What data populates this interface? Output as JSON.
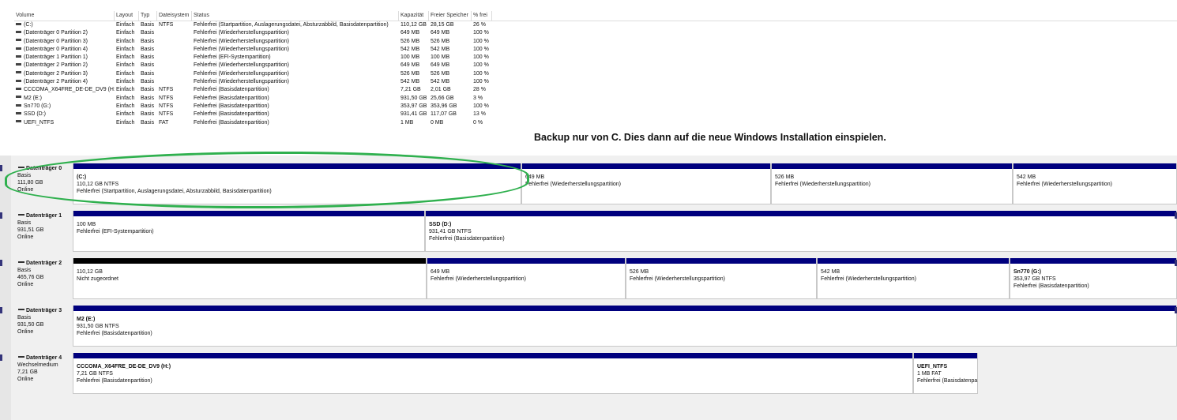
{
  "volume_list": {
    "headers": [
      "Volume",
      "Layout",
      "Typ",
      "Dateisystem",
      "Status",
      "Kapazität",
      "Freier Speicher",
      "% frei"
    ],
    "rows": [
      [
        "(C:)",
        "Einfach",
        "Basis",
        "NTFS",
        "Fehlerfrei (Startpartition, Auslagerungsdatei, Absturzabbild, Basisdatenpartition)",
        "110,12 GB",
        "28,15 GB",
        "26 %"
      ],
      [
        "(Datenträger 0 Partition 2)",
        "Einfach",
        "Basis",
        "",
        "Fehlerfrei (Wiederherstellungspartition)",
        "649 MB",
        "649 MB",
        "100 %"
      ],
      [
        "(Datenträger 0 Partition 3)",
        "Einfach",
        "Basis",
        "",
        "Fehlerfrei (Wiederherstellungspartition)",
        "526 MB",
        "526 MB",
        "100 %"
      ],
      [
        "(Datenträger 0 Partition 4)",
        "Einfach",
        "Basis",
        "",
        "Fehlerfrei (Wiederherstellungspartition)",
        "542 MB",
        "542 MB",
        "100 %"
      ],
      [
        "(Datenträger 1 Partition 1)",
        "Einfach",
        "Basis",
        "",
        "Fehlerfrei (EFI-Systempartition)",
        "100 MB",
        "100 MB",
        "100 %"
      ],
      [
        "(Datenträger 2 Partition 2)",
        "Einfach",
        "Basis",
        "",
        "Fehlerfrei (Wiederherstellungspartition)",
        "649 MB",
        "649 MB",
        "100 %"
      ],
      [
        "(Datenträger 2 Partition 3)",
        "Einfach",
        "Basis",
        "",
        "Fehlerfrei (Wiederherstellungspartition)",
        "526 MB",
        "526 MB",
        "100 %"
      ],
      [
        "(Datenträger 2 Partition 4)",
        "Einfach",
        "Basis",
        "",
        "Fehlerfrei (Wiederherstellungspartition)",
        "542 MB",
        "542 MB",
        "100 %"
      ],
      [
        "CCCOMA_X64FRE_DE-DE_DV9 (H:)",
        "Einfach",
        "Basis",
        "NTFS",
        "Fehlerfrei (Basisdatenpartition)",
        "7,21 GB",
        "2,01 GB",
        "28 %"
      ],
      [
        "M2 (E:)",
        "Einfach",
        "Basis",
        "NTFS",
        "Fehlerfrei (Basisdatenpartition)",
        "931,50 GB",
        "25,66 GB",
        "3 %"
      ],
      [
        "Sn770 (G:)",
        "Einfach",
        "Basis",
        "NTFS",
        "Fehlerfrei (Basisdatenpartition)",
        "353,97 GB",
        "353,96 GB",
        "100 %"
      ],
      [
        "SSD (D:)",
        "Einfach",
        "Basis",
        "NTFS",
        "Fehlerfrei (Basisdatenpartition)",
        "931,41 GB",
        "117,07 GB",
        "13 %"
      ],
      [
        "UEFI_NTFS",
        "Einfach",
        "Basis",
        "FAT",
        "Fehlerfrei (Basisdatenpartition)",
        "1 MB",
        "0 MB",
        "0 %"
      ]
    ]
  },
  "annotation": "Backup nur von C. Dies dann auf die neue Windows Installation einspielen.",
  "highlight_color": "#2fb04e",
  "partition_bar_color": "#00007e",
  "disks": [
    {
      "name": "Datenträger 0",
      "type": "Basis",
      "size": "111,80 GB",
      "state": "Online",
      "partitions": [
        {
          "name": "(C:)",
          "size": "110,12 GB NTFS",
          "status": "Fehlerfrei (Startpartition, Auslagerungsdatei, Absturzabbild, Basisdatenpartition)"
        },
        {
          "name": "",
          "size": "649 MB",
          "status": "Fehlerfrei (Wiederherstellungspartition)"
        },
        {
          "name": "",
          "size": "526 MB",
          "status": "Fehlerfrei (Wiederherstellungspartition)"
        },
        {
          "name": "",
          "size": "542 MB",
          "status": "Fehlerfrei (Wiederherstellungspartition)"
        }
      ]
    },
    {
      "name": "Datenträger 1",
      "type": "Basis",
      "size": "931,51 GB",
      "state": "Online",
      "partitions": [
        {
          "name": "",
          "size": "100 MB",
          "status": "Fehlerfrei (EFI-Systempartition)"
        },
        {
          "name": "SSD (D:)",
          "size": "931,41 GB NTFS",
          "status": "Fehlerfrei (Basisdatenpartition)"
        }
      ]
    },
    {
      "name": "Datenträger 2",
      "type": "Basis",
      "size": "465,76 GB",
      "state": "Online",
      "partitions": [
        {
          "name": "",
          "size": "110,12 GB",
          "status": "Nicht zugeordnet"
        },
        {
          "name": "",
          "size": "649 MB",
          "status": "Fehlerfrei (Wiederherstellungspartition)"
        },
        {
          "name": "",
          "size": "526 MB",
          "status": "Fehlerfrei (Wiederherstellungspartition)"
        },
        {
          "name": "",
          "size": "542 MB",
          "status": "Fehlerfrei (Wiederherstellungspartition)"
        },
        {
          "name": "Sn770 (G:)",
          "size": "353,97 GB NTFS",
          "status": "Fehlerfrei (Basisdatenpartition)"
        }
      ]
    },
    {
      "name": "Datenträger 3",
      "type": "Basis",
      "size": "931,50 GB",
      "state": "Online",
      "partitions": [
        {
          "name": "M2 (E:)",
          "size": "931,50 GB NTFS",
          "status": "Fehlerfrei (Basisdatenpartition)"
        }
      ]
    },
    {
      "name": "Datenträger 4",
      "type": "Wechselmedium",
      "size": "7,21 GB",
      "state": "Online",
      "partitions": [
        {
          "name": "CCCOMA_X64FRE_DE-DE_DV9 (H:)",
          "size": "7,21 GB NTFS",
          "status": "Fehlerfrei (Basisdatenpartition)"
        },
        {
          "name": "UEFI_NTFS",
          "size": "1 MB FAT",
          "status": "Fehlerfrei (Basisdatenpa"
        }
      ]
    }
  ]
}
